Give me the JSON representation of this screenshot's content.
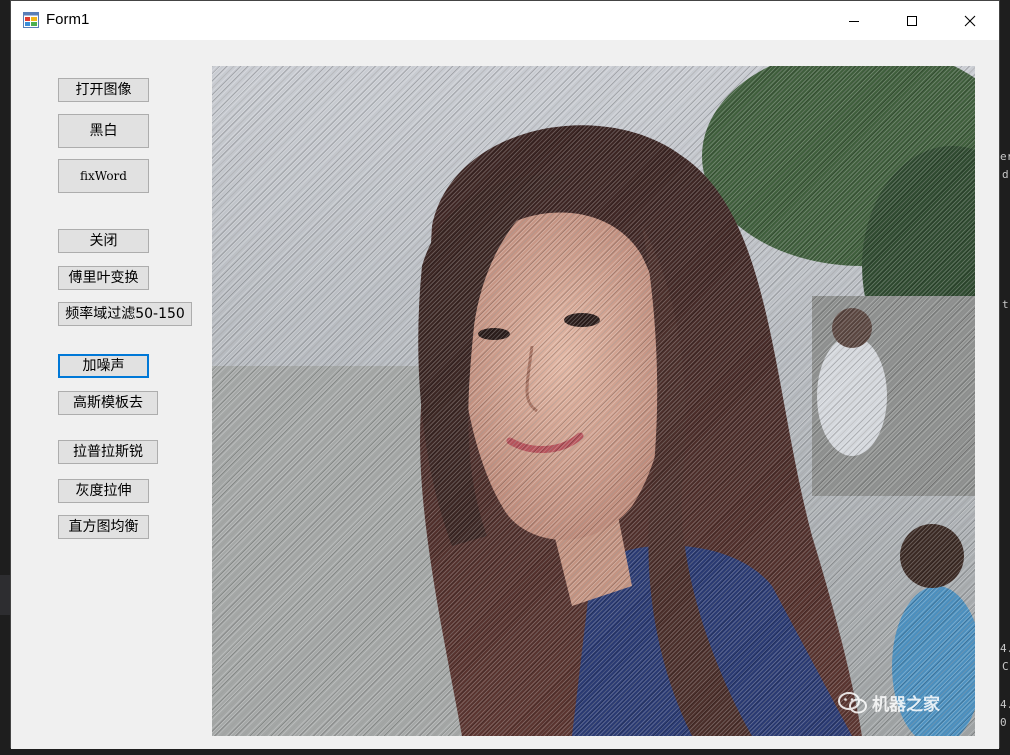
{
  "window": {
    "title": "Form1"
  },
  "buttons": {
    "open_image": "打开图像",
    "black_white": "黑白",
    "fix_word": "fixWord",
    "close": "关闭",
    "fourier": "傅里叶变换",
    "freq_filter": "频率域过滤50-150",
    "add_noise": "加噪声",
    "gaussian": "高斯模板去",
    "laplacian": "拉普拉斯锐",
    "gray_stretch": "灰度拉伸",
    "histogram_eq": "直方图均衡"
  },
  "picture": {
    "watermark": "机器之家"
  },
  "background": {
    "line1": "er",
    "line2": "d",
    "line3": "t",
    "line4": "4.",
    "line5": "C",
    "line6": "4.",
    "line7": "0"
  },
  "colors": {
    "focus_border": "#0078d7",
    "button_face": "#e1e1e1",
    "form_back": "#f0f0f0"
  }
}
